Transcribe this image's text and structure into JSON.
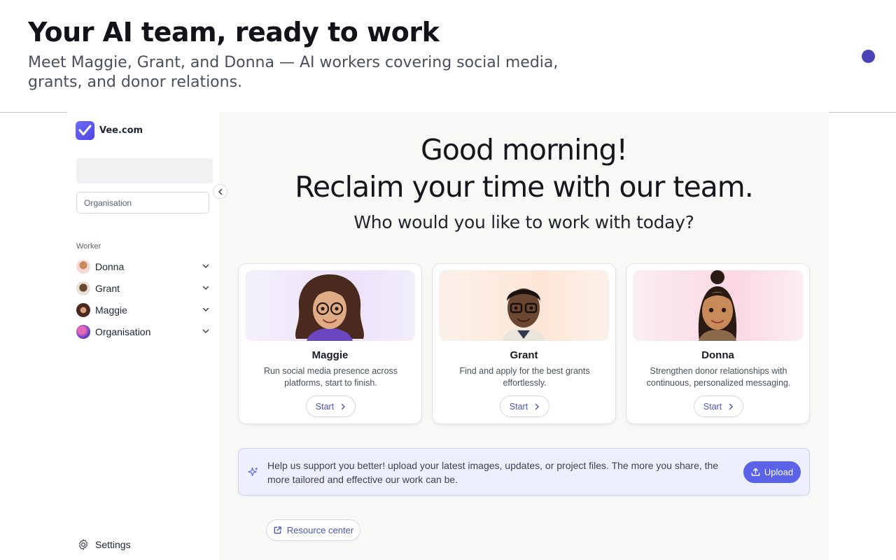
{
  "slide": {
    "title": "Your AI team, ready to work",
    "subtitle": "Meet Maggie, Grant, and Donna — AI workers covering social media, grants, and donor relations."
  },
  "sidebar": {
    "brand_name": "Vee.com",
    "org_placeholder": "Organisation",
    "worker_section_label": "Worker",
    "workers": [
      {
        "label": "Donna"
      },
      {
        "label": "Grant"
      },
      {
        "label": "Maggie"
      },
      {
        "label": "Organisation"
      }
    ],
    "settings_label": "Settings"
  },
  "main": {
    "greeting": "Good morning!",
    "tagline": "Reclaim your time with our team.",
    "question": "Who would you like to work with today?",
    "cards": [
      {
        "name": "Maggie",
        "description": "Run social media presence across platforms, start to finish.",
        "button": "Start"
      },
      {
        "name": "Grant",
        "description": "Find and apply for the best grants effortlessly.",
        "button": "Start"
      },
      {
        "name": "Donna",
        "description": "Strengthen donor relationships with continuous, personalized messaging.",
        "button": "Start"
      }
    ],
    "upload_message": "Help us support you better! upload your latest images, updates, or project files. The more you share, the more tailored and effective our work can be.",
    "upload_button": "Upload",
    "resource_button": "Resource center"
  },
  "colors": {
    "accent": "#5b63e8",
    "hero_dot": "#4a43b8",
    "upload_bar_bg": "#edeffc"
  }
}
